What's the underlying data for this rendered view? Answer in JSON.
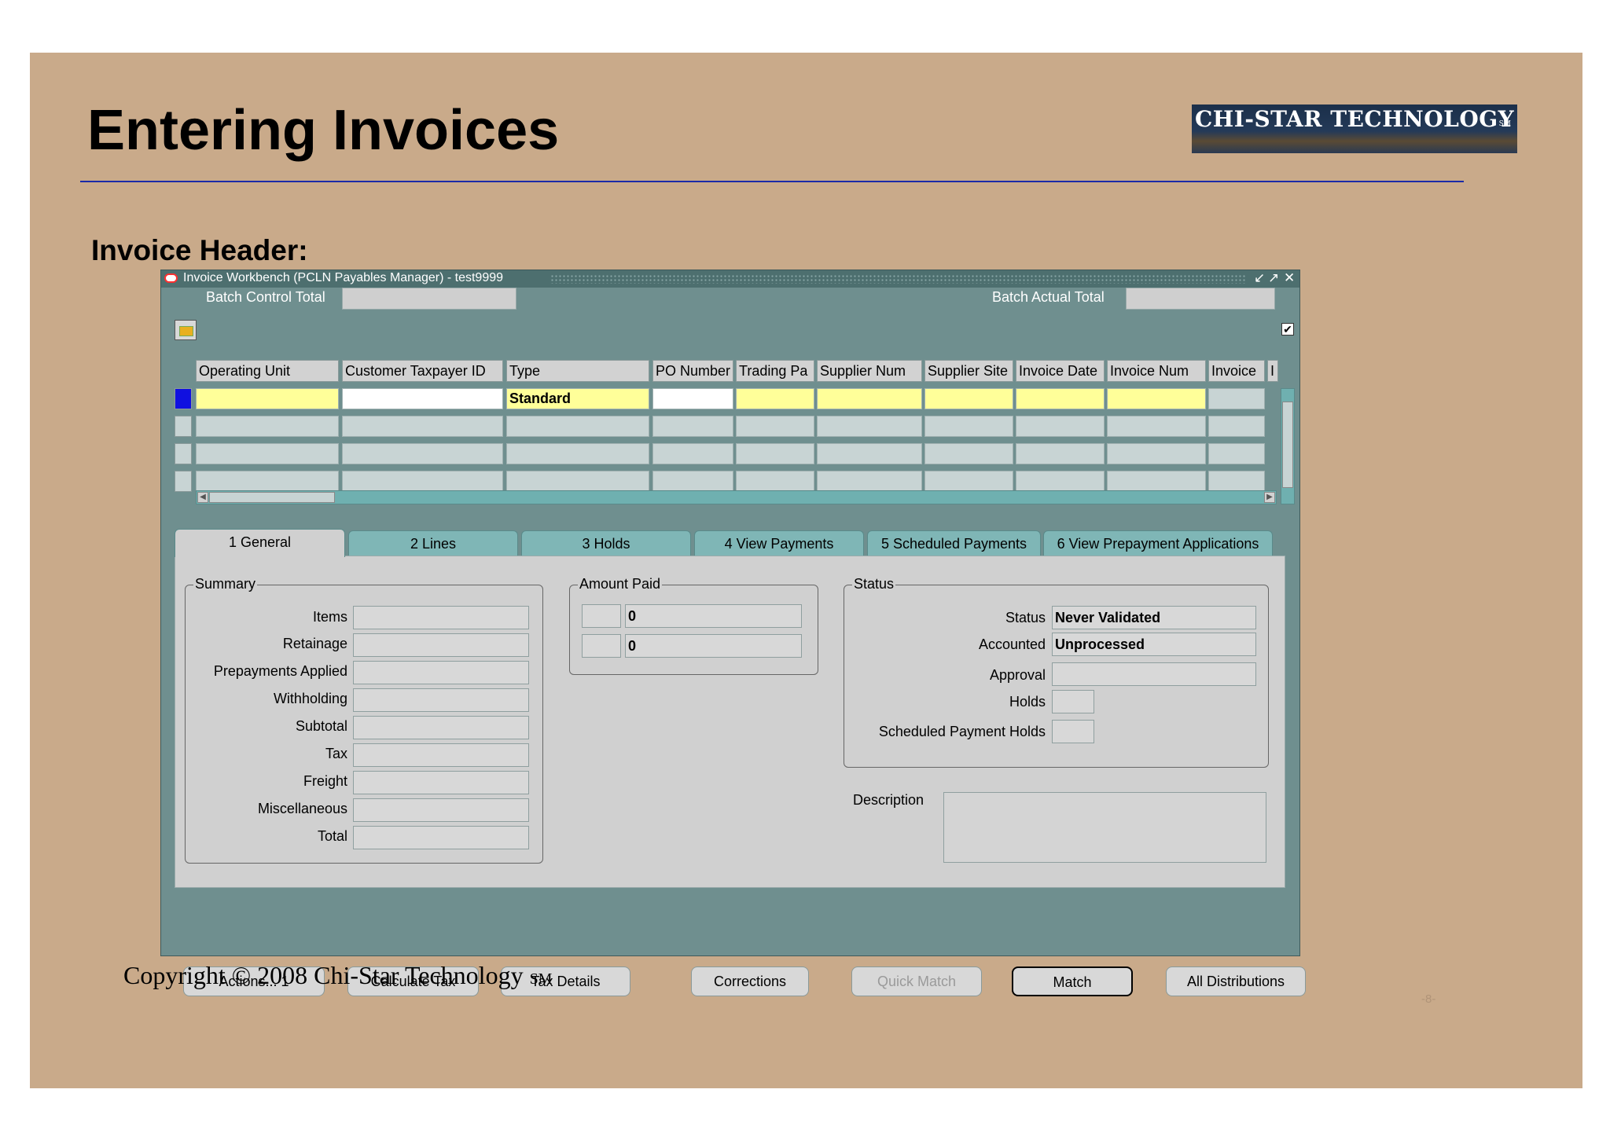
{
  "slide": {
    "logo_text": "CHI-STAR TECHNOLOGY",
    "logo_mark": "SM",
    "title": "Entering Invoices",
    "subtitle": "Invoice Header:",
    "copyright": "Copyright © 2008 Chi-Star Technology",
    "copyright_mark": "SM",
    "page_number": "-8-",
    "colors": {
      "background": "#c9aa8a",
      "rule": "#1a2aa8"
    }
  },
  "window": {
    "title": "Invoice Workbench (PCLN Payables Manager) - test9999",
    "controls": [
      "↙",
      "↗",
      "✕"
    ],
    "batch_control_total_label": "Batch Control Total",
    "batch_control_total_value": "",
    "batch_actual_total_label": "Batch Actual Total",
    "batch_actual_total_value": "",
    "toolbar_icon": "folder-open-icon",
    "checkbox_checked": true,
    "columns": [
      "Operating Unit",
      "Customer Taxpayer ID",
      "Type",
      "PO Number",
      "Trading Pa",
      "Supplier Num",
      "Supplier Site",
      "Invoice Date",
      "Invoice Num",
      "Invoice",
      "I"
    ],
    "rows": [
      [
        "",
        "",
        "Standard",
        "",
        "",
        "",
        "",
        "",
        "",
        ""
      ],
      [
        "",
        "",
        "",
        "",
        "",
        "",
        "",
        "",
        "",
        ""
      ],
      [
        "",
        "",
        "",
        "",
        "",
        "",
        "",
        "",
        "",
        ""
      ],
      [
        "",
        "",
        "",
        "",
        "",
        "",
        "",
        "",
        "",
        ""
      ]
    ],
    "tabs": [
      {
        "label": "1 General",
        "active": true
      },
      {
        "label": "2 Lines",
        "active": false
      },
      {
        "label": "3 Holds",
        "active": false
      },
      {
        "label": "4 View Payments",
        "active": false
      },
      {
        "label": "5 Scheduled Payments",
        "active": false
      },
      {
        "label": "6 View Prepayment Applications",
        "active": false
      }
    ],
    "summary": {
      "title": "Summary",
      "fields": [
        {
          "label": "Items",
          "value": ""
        },
        {
          "label": "Retainage",
          "value": ""
        },
        {
          "label": "Prepayments Applied",
          "value": ""
        },
        {
          "label": "Withholding",
          "value": ""
        },
        {
          "label": "Subtotal",
          "value": ""
        },
        {
          "label": "Tax",
          "value": ""
        },
        {
          "label": "Freight",
          "value": ""
        },
        {
          "label": "Miscellaneous",
          "value": ""
        },
        {
          "label": "Total",
          "value": ""
        }
      ]
    },
    "amount_paid": {
      "title": "Amount Paid",
      "rows": [
        {
          "currency": "",
          "value": "0"
        },
        {
          "currency": "",
          "value": "0"
        }
      ]
    },
    "status": {
      "title": "Status",
      "fields": [
        {
          "label": "Status",
          "value": "Never Validated"
        },
        {
          "label": "Accounted",
          "value": "Unprocessed"
        },
        {
          "label": "Approval",
          "value": ""
        },
        {
          "label": "Holds",
          "value": ""
        },
        {
          "label": "Scheduled Payment Holds",
          "value": ""
        }
      ]
    },
    "description_label": "Description",
    "description_value": "",
    "buttons": [
      {
        "label": "Actions... 1",
        "state": "normal"
      },
      {
        "label": "Calculate Tax",
        "state": "normal"
      },
      {
        "label": "Tax Details",
        "state": "normal"
      },
      {
        "label": "Corrections",
        "state": "normal"
      },
      {
        "label": "Quick Match",
        "state": "disabled"
      },
      {
        "label": "Match",
        "state": "default"
      },
      {
        "label": "All Distributions",
        "state": "normal"
      }
    ],
    "colors": {
      "frame": "#6f8f8f",
      "required": "#ffff99",
      "active_row": "#1010e0",
      "tab": "#7fb6b6"
    }
  }
}
